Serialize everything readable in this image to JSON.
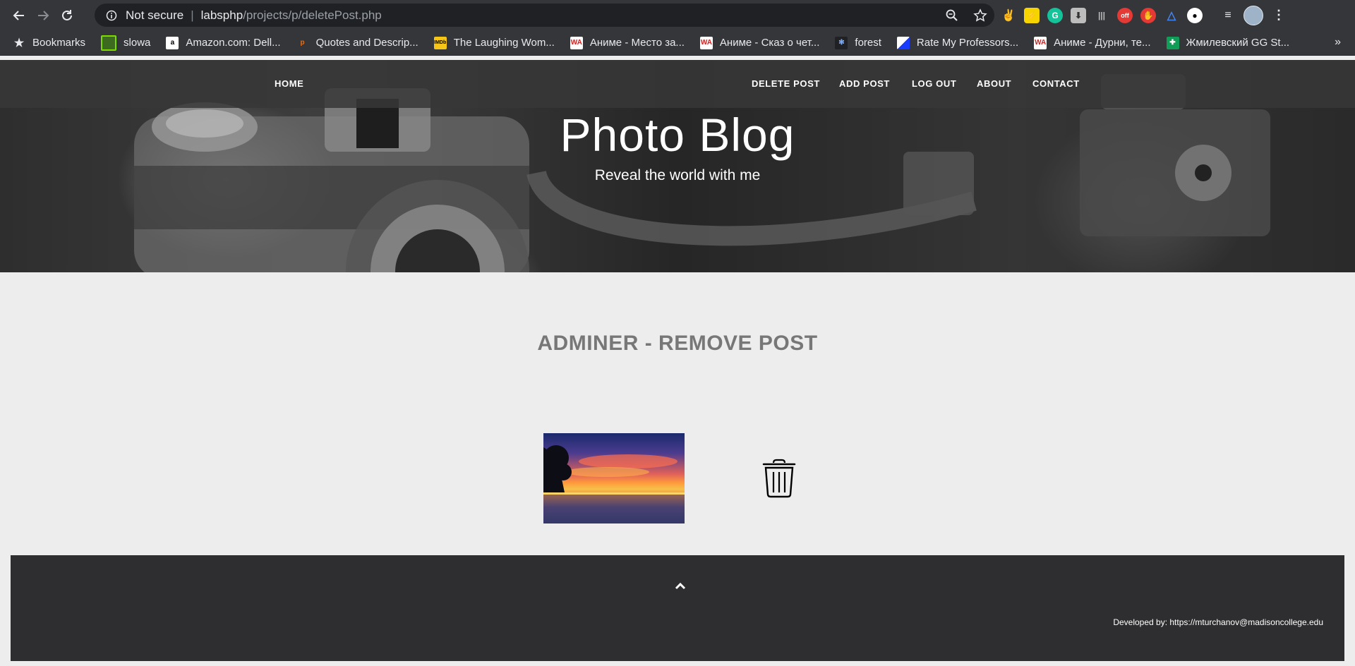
{
  "browser": {
    "security_label": "Not secure",
    "url_host": "labsphp",
    "url_path": "/projects/p/deletePost.php",
    "bookmarks": [
      {
        "label": "Bookmarks",
        "icon": "star-icon"
      },
      {
        "label": "slowa",
        "icon": "slowa-favicon"
      },
      {
        "label": "Amazon.com: Dell...",
        "icon": "amazon-favicon"
      },
      {
        "label": "Quotes and Descrip...",
        "icon": "quotes-favicon"
      },
      {
        "label": "The Laughing Wom...",
        "icon": "imdb-favicon"
      },
      {
        "label": "Аниме - Место за...",
        "icon": "wa-favicon"
      },
      {
        "label": "Аниме - Сказ о чет...",
        "icon": "wa-favicon"
      },
      {
        "label": "forest",
        "icon": "forest-favicon"
      },
      {
        "label": "Rate My Professors...",
        "icon": "rmp-favicon"
      },
      {
        "label": "Аниме - Дурни, те...",
        "icon": "wa-favicon"
      },
      {
        "label": "Жмилевский GG St...",
        "icon": "sheets-favicon"
      }
    ],
    "more_label": "»"
  },
  "nav": {
    "home": "HOME",
    "delete_post": "DELETE POST",
    "add_post": "ADD POST",
    "log_out": "LOG OUT",
    "about": "ABOUT",
    "contact": "CONTACT"
  },
  "hero": {
    "title": "Photo Blog",
    "subtitle": "Reveal the world with me"
  },
  "main": {
    "heading": "ADMINER - REMOVE POST"
  },
  "footer": {
    "credit": "Developed by: https://mturchanov@madisoncollege.edu"
  },
  "colors": {
    "page_bg": "#ededed",
    "footer_bg": "#2e2e30",
    "chrome_bg": "#35363a",
    "heading": "#777777"
  }
}
